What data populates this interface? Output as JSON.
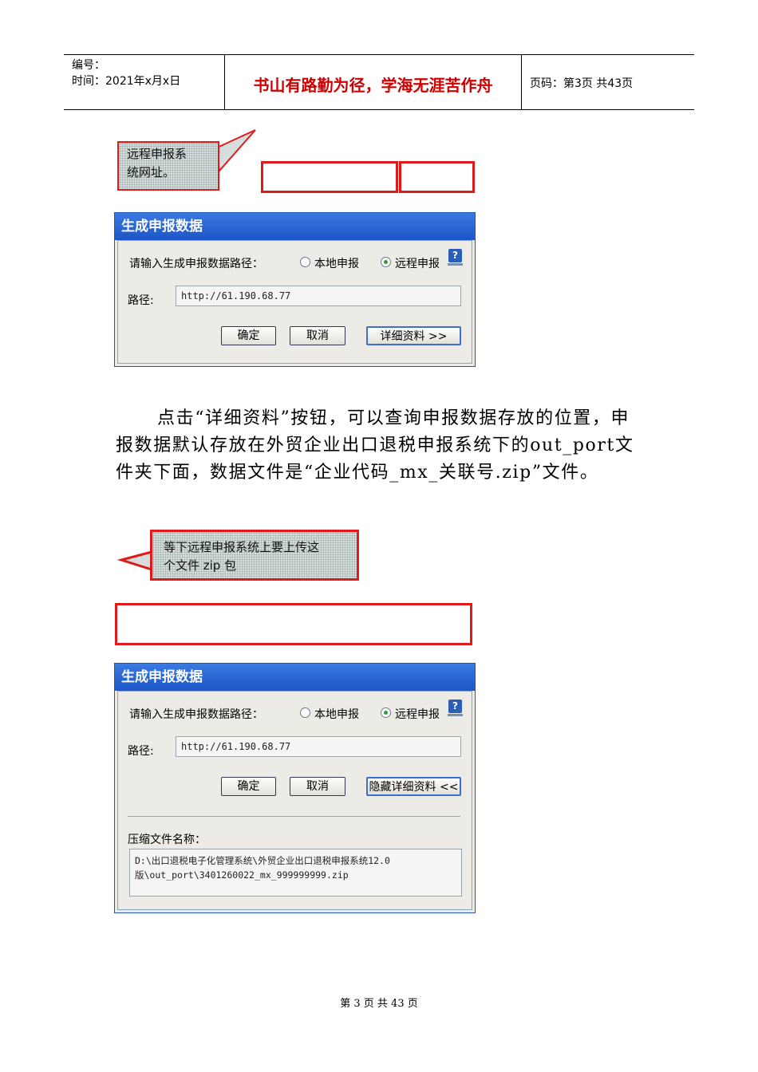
{
  "header": {
    "number_label": "编号：",
    "time_label": "时间：2021年x月x日",
    "motto": "书山有路勤为径，学海无涯苦作舟",
    "page_info": "页码：第3页  共43页"
  },
  "callout1": {
    "line1": "远程申报系",
    "line2": "统网址。"
  },
  "callout2": {
    "line1": "等下远程申报系统上要上传这",
    "line2": "个文件 zip 包"
  },
  "dialog1": {
    "title": "生成申报数据",
    "prompt": "请输入生成申报数据路径：",
    "radio_local": "本地申报",
    "radio_remote": "远程申报",
    "help": "?",
    "path_label": "路径:",
    "path_value": "http://61.190.68.77",
    "ok": "确定",
    "cancel": "取消",
    "details": "详细资料 >>"
  },
  "paragraph": "点击“详细资料”按钮，可以查询申报数据存放的位置，申报数据默认存放在外贸企业出口退税申报系统下的out_port文件夹下面，数据文件是“企业代码_mx_关联号.zip”文件。",
  "dialog2": {
    "title": "生成申报数据",
    "prompt": "请输入生成申报数据路径：",
    "radio_local": "本地申报",
    "radio_remote": "远程申报",
    "help": "?",
    "path_label": "路径:",
    "path_value": "http://61.190.68.77",
    "ok": "确定",
    "cancel": "取消",
    "details": "隐藏详细资料 <<",
    "zip_label": "压缩文件名称：",
    "zip_line1": "D:\\出口退税电子化管理系统\\外贸企业出口退税申报系统12.0",
    "zip_line2": "版\\out_port\\3401260022_mx_999999999.zip"
  },
  "footer": "第 3 页 共 43 页"
}
